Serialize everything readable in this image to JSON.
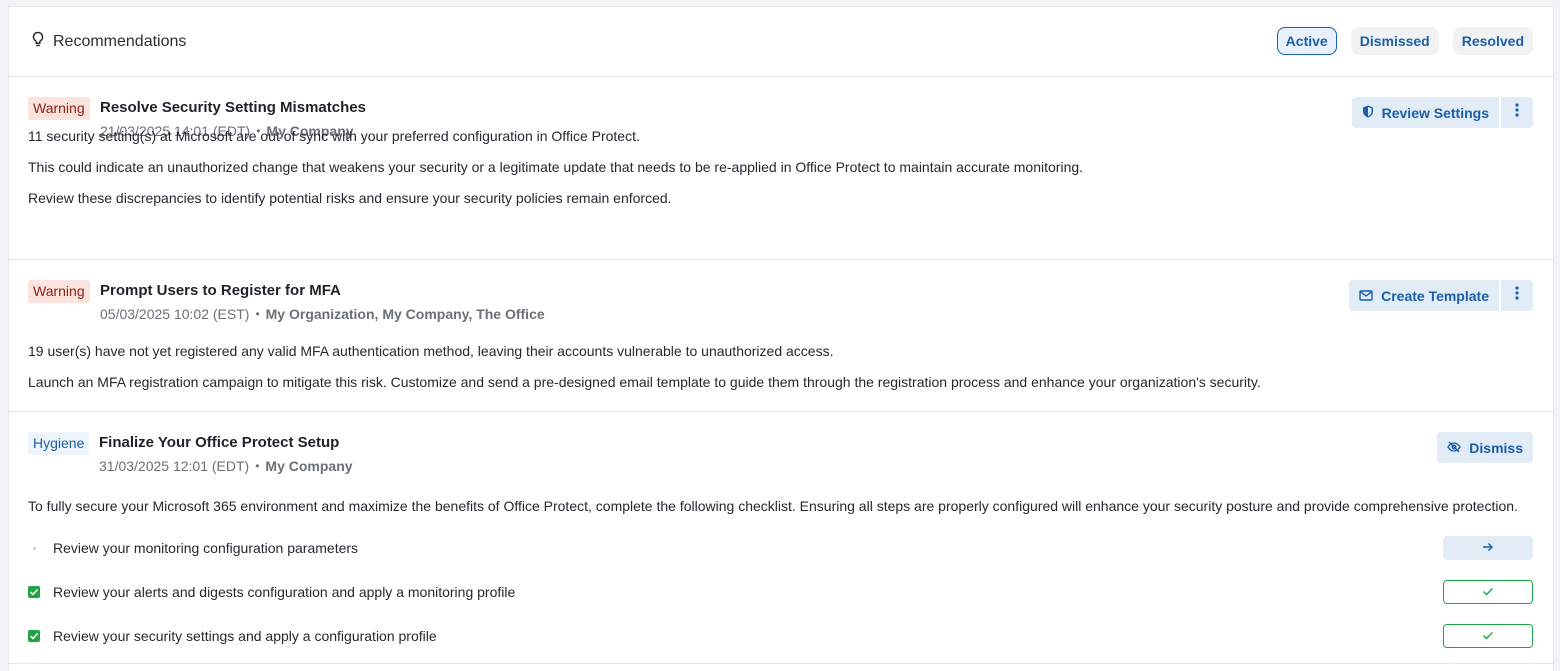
{
  "header": {
    "title": "Recommendations",
    "tabs": [
      {
        "label": "Active",
        "active": true
      },
      {
        "label": "Dismissed",
        "active": false
      },
      {
        "label": "Resolved",
        "active": false
      }
    ]
  },
  "recommendations": [
    {
      "badge": "Warning",
      "title": "Resolve Security Setting Mismatches",
      "date": "21/03/2025 14:01 (EDT)",
      "orgs": "My Company",
      "action_label": "Review Settings",
      "action_icon": "shield-icon",
      "paragraphs": [
        "11 security setting(s) at Microsoft are out of sync with your preferred configuration in Office Protect.",
        "This could indicate an unauthorized change that weakens your security or a legitimate update that needs to be re-applied in Office Protect to maintain accurate monitoring.",
        "Review these discrepancies to identify potential risks and ensure your security policies remain enforced."
      ]
    },
    {
      "badge": "Warning",
      "title": "Prompt Users to Register for MFA",
      "date": "05/03/2025 10:02 (EST)",
      "orgs": "My Organization, My Company, The Office",
      "action_label": "Create Template",
      "action_icon": "mail-icon",
      "paragraphs": [
        "19 user(s) have not yet registered any valid MFA authentication method, leaving their accounts vulnerable to unauthorized access.",
        "Launch an MFA registration campaign to mitigate this risk. Customize and send a pre-designed email template to guide them through the registration process and enhance your organization's security."
      ]
    },
    {
      "badge": "Hygiene",
      "title": "Finalize Your Office Protect Setup",
      "date": "31/03/2025 12:01 (EDT)",
      "orgs": "My Company",
      "action_label": "Dismiss",
      "action_icon": "eye-off-icon",
      "paragraphs": [
        "To fully secure your Microsoft 365 environment and maximize the benefits of Office Protect, complete the following checklist. Ensuring all steps are properly configured will enhance your security posture and provide comprehensive protection."
      ],
      "checklist": [
        {
          "label": "Review your monitoring configuration parameters",
          "done": false
        },
        {
          "label": "Review your alerts and digests configuration and apply a monitoring profile",
          "done": true
        },
        {
          "label": "Review your security settings and apply a configuration profile",
          "done": true
        }
      ]
    }
  ],
  "colors": {
    "accent": "#1b5fa8",
    "warning_bg": "#fde3dd",
    "success": "#1ea345"
  }
}
